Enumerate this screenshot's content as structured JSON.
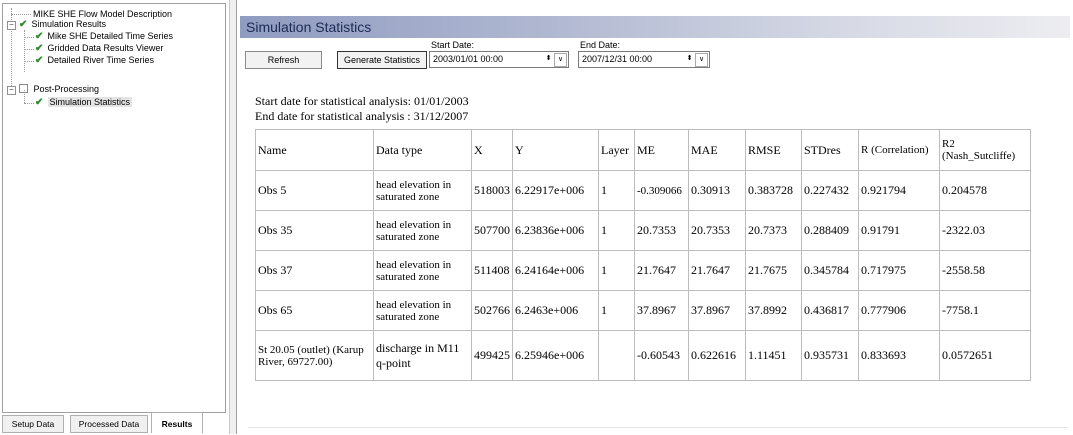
{
  "tree": {
    "items": [
      {
        "label": "MIKE SHE Flow Model Description"
      },
      {
        "label": "Simulation Results"
      },
      {
        "label": "Mike SHE Detailed Time Series"
      },
      {
        "label": "Gridded Data Results Viewer"
      },
      {
        "label": "Detailed River Time Series"
      },
      {
        "label": "Post-Processing"
      },
      {
        "label": "Simulation Statistics"
      }
    ],
    "expander_minus": "−",
    "check_glyph": "✔"
  },
  "tabs": [
    "Setup Data",
    "Processed Data",
    "Results"
  ],
  "panel": {
    "title": "Simulation Statistics",
    "refresh_label": "Refresh",
    "generate_label": "Generate Statistics",
    "start_label": "Start Date:",
    "start_value": "2003/01/01  00:00",
    "end_label": "End Date:",
    "end_value": "2007/12/31  00:00",
    "spin_glyph": "⬍",
    "dd_glyph": "∨"
  },
  "report": {
    "start_line": "Start date for statistical analysis: 01/01/2003",
    "end_line": "End date for statistical analysis : 31/12/2007",
    "headers": [
      "Name",
      "Data type",
      "X",
      "Y",
      "Layer",
      "ME",
      "MAE",
      "RMSE",
      "STDres",
      "R (Correlation)",
      "R2 (Nash_Sutcliffe)"
    ],
    "rows": [
      [
        "Obs 5",
        "head elevation in saturated zone",
        "518003",
        "6.22917e+006",
        "1",
        "-0.309066",
        "0.30913",
        "0.383728",
        "0.227432",
        "0.921794",
        "0.204578"
      ],
      [
        "Obs 35",
        "head elevation in saturated zone",
        "507700",
        "6.23836e+006",
        "1",
        "20.7353",
        "20.7353",
        "20.7373",
        "0.288409",
        "0.91791",
        "-2322.03"
      ],
      [
        "Obs 37",
        "head elevation in saturated zone",
        "511408",
        "6.24164e+006",
        "1",
        "21.7647",
        "21.7647",
        "21.7675",
        "0.345784",
        "0.717975",
        "-2558.58"
      ],
      [
        "Obs 65",
        "head elevation in saturated zone",
        "502766",
        "6.2463e+006",
        "1",
        "37.8967",
        "37.8967",
        "37.8992",
        "0.436817",
        "0.777906",
        "-7758.1"
      ],
      [
        "St 20.05 (outlet) (Karup River, 69727.00)",
        "discharge in M11 q-point",
        "499425",
        "6.25946e+006",
        "",
        "-0.60543",
        "0.622616",
        "1.11451",
        "0.935731",
        "0.833693",
        "0.0572651"
      ]
    ]
  },
  "colors": {
    "check": "#2e8b2e",
    "title_text": "#1c2a55"
  }
}
